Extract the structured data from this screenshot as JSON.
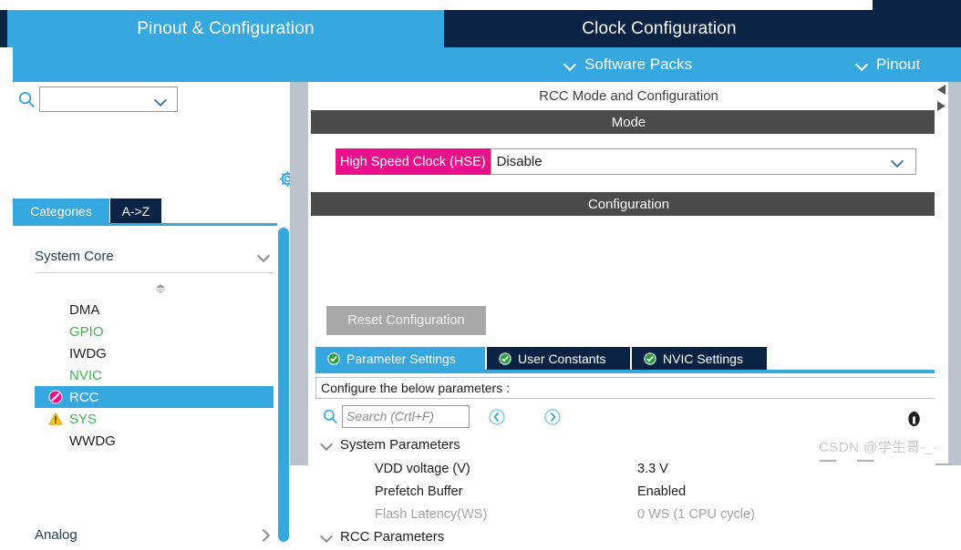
{
  "main_tabs": [
    {
      "label": "Pinout & Configuration",
      "active": true
    },
    {
      "label": "Clock Configuration",
      "active": false
    },
    {
      "label": "",
      "active": false
    }
  ],
  "subbar": {
    "software_packs": "Software Packs",
    "pinout": "Pinout"
  },
  "left_panel": {
    "search_combo_value": "",
    "gear_icon": "gear-icon",
    "search_icon": "search-icon",
    "tabs": [
      {
        "label": "Categories",
        "active": true
      },
      {
        "label": "A->Z",
        "active": false
      }
    ],
    "groups": [
      {
        "label": "System Core",
        "expanded": true,
        "items": [
          {
            "label": "DMA",
            "state": "normal",
            "icon": "none"
          },
          {
            "label": "GPIO",
            "state": "configured",
            "icon": "none"
          },
          {
            "label": "IWDG",
            "state": "normal",
            "icon": "none"
          },
          {
            "label": "NVIC",
            "state": "configured",
            "icon": "none"
          },
          {
            "label": "RCC",
            "state": "selected",
            "icon": "forbidden-icon"
          },
          {
            "label": "SYS",
            "state": "configured",
            "icon": "warning-icon"
          },
          {
            "label": "WWDG",
            "state": "normal",
            "icon": "none"
          }
        ]
      },
      {
        "label": "Analog",
        "expanded": false,
        "items": []
      }
    ]
  },
  "right_panel": {
    "title": "RCC Mode and Configuration",
    "mode_section": {
      "header": "Mode",
      "row": {
        "label": "High Speed Clock (HSE)",
        "value": "Disable"
      }
    },
    "configuration_section": {
      "header": "Configuration",
      "reset_button": "Reset Configuration",
      "tabs": [
        {
          "label": "Parameter Settings",
          "active": true,
          "icon": "check-circle-icon"
        },
        {
          "label": "User Constants",
          "active": false,
          "icon": "check-circle-icon"
        },
        {
          "label": "NVIC Settings",
          "active": false,
          "icon": "check-circle-icon"
        }
      ],
      "banner": "Configure the below parameters :",
      "search": {
        "placeholder": "Search (Crtl+F)",
        "value": "",
        "prev_icon": "prev-arrow-icon",
        "next_icon": "next-arrow-icon",
        "info_icon": "info-icon"
      },
      "param_groups": [
        {
          "label": "System Parameters",
          "expanded": true,
          "rows": [
            {
              "name": "VDD voltage (V)",
              "value": "3.3 V",
              "disabled": false
            },
            {
              "name": "Prefetch Buffer",
              "value": "Enabled",
              "disabled": false
            },
            {
              "name": "Flash Latency(WS)",
              "value": "0 WS (1 CPU cycle)",
              "disabled": true
            }
          ]
        },
        {
          "label": "RCC Parameters",
          "expanded": true,
          "rows": []
        }
      ]
    }
  },
  "watermark": "CSDN @学生哥-_-",
  "colors": {
    "accent_blue": "#35a8e0",
    "navy": "#0a2244",
    "magenta": "#ec0f8c",
    "section_gray": "#4b4b4b",
    "green": "#3db34a",
    "warning_yellow": "#f5c518"
  }
}
